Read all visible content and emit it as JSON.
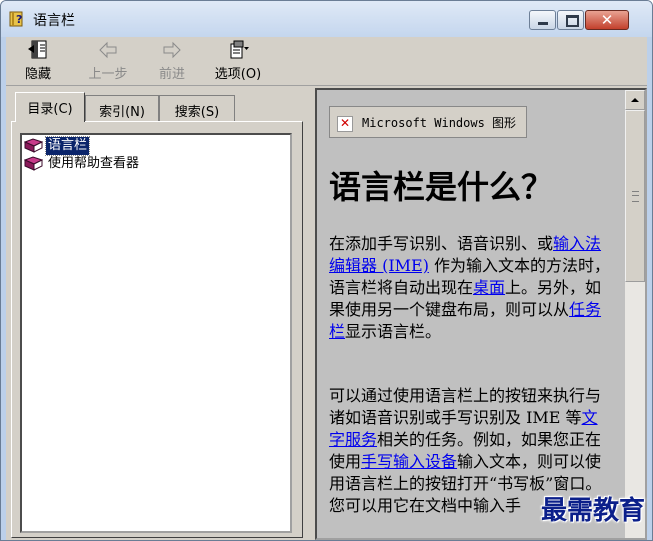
{
  "window": {
    "title": "语言栏"
  },
  "toolbar": {
    "hide_label": "隐藏",
    "back_label": "上一步",
    "forward_label": "前进",
    "options_label": "选项(O)"
  },
  "tabs": [
    {
      "label": "目录(C)"
    },
    {
      "label": "索引(N)"
    },
    {
      "label": "搜索(S)"
    }
  ],
  "tree": {
    "items": [
      {
        "label": "语言栏",
        "selected": true
      },
      {
        "label": "使用帮助查看器",
        "selected": false
      }
    ]
  },
  "content": {
    "image_alt": "Microsoft Windows 图形",
    "heading": "语言栏是什么？",
    "para1": {
      "t1": "在添加手写识别、语音识别、或",
      "link1": "输入法编辑器 (IME)",
      "t2": " 作为输入文本的方法时，语言栏将自动出现在",
      "link2": "桌面",
      "t3": "上。另外，如果使用另一个键盘布局，则可以从",
      "link3": "任务栏",
      "t4": "显示语言栏。"
    },
    "para2": {
      "t1": "可以通过使用语言栏上的按钮来执行与诸如语音识别或手写识别及 IME 等",
      "link1": "文字服务",
      "t2": "相关的任务。例如，如果您正在使用",
      "link2": "手写输入设备",
      "t3": "输入文本，则可以使用语言栏上的按钮打开“书写板”窗口。您可以用它在文档中输入手"
    }
  },
  "watermark": "最需教育",
  "colors": {
    "selection": "#0a246a",
    "link": "#0000ee",
    "face": "#d4d0c8",
    "watermark": "#0b1f8a"
  }
}
